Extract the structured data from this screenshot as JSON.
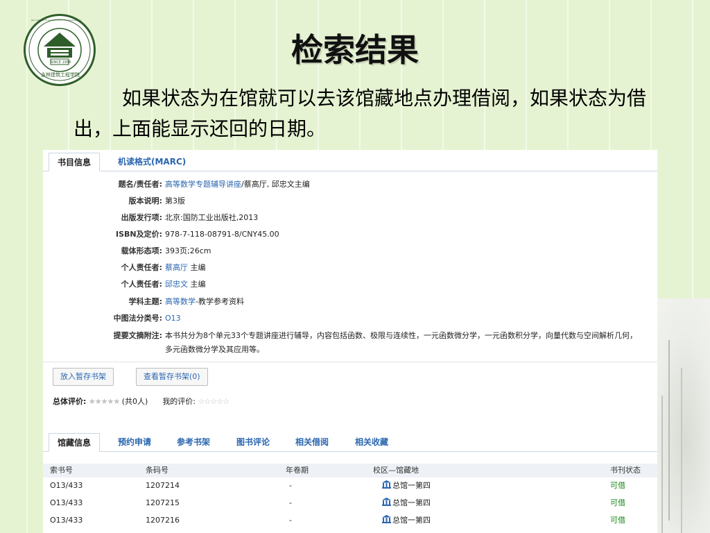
{
  "slide": {
    "title": "检索结果",
    "body": "如果状态为在馆就可以去该馆藏地点办理借阅，如果状态为借出，上面能显示还回的日期。"
  },
  "logo": {
    "ring_text": "Jilin Institute Of Architecture & Civil Engineering",
    "since": "SINCE 1956",
    "cn_name": "吉林建筑工程学院"
  },
  "tabs_top": [
    "书目信息",
    "机读格式(MARC)"
  ],
  "record": {
    "fields": [
      {
        "label": "题名/责任者:",
        "link": "高等数学专题辅导讲座",
        "rest": "/蔡高厅, 邱忠文主编"
      },
      {
        "label": "版本说明:",
        "link": "",
        "rest": "第3版"
      },
      {
        "label": "出版发行项:",
        "link": "",
        "rest": "北京:国防工业出版社,2013"
      },
      {
        "label": "ISBN及定价:",
        "link": "",
        "rest": "978-7-118-08791-8/CNY45.00"
      },
      {
        "label": "载体形态项:",
        "link": "",
        "rest": "393页;26cm"
      },
      {
        "label": "个人责任者:",
        "link": "蔡高厅",
        "rest": " 主编"
      },
      {
        "label": "个人责任者:",
        "link": "邱忠文",
        "rest": " 主编"
      },
      {
        "label": "学科主题:",
        "link": "高等数学",
        "rest": "-教学参考资料"
      },
      {
        "label": "中图法分类号:",
        "link": "O13",
        "rest": ""
      },
      {
        "label": "提要文摘附注:",
        "link": "",
        "rest": "本书共分为8个单元33个专题讲座进行辅导，内容包括函数、极限与连续性，一元函数微分学，一元函数积分学，向量代数与空间解析几何，多元函数微分学及其应用等。"
      }
    ]
  },
  "buttons": {
    "add_shelf": "放入暂存书架",
    "view_shelf": "查看暂存书架(0)"
  },
  "rating": {
    "overall_label": "总体评价:",
    "overall_count": "(共0人)",
    "my_label": "我的评价:"
  },
  "tabs_bottom": [
    "馆藏信息",
    "预约申请",
    "参考书架",
    "图书评论",
    "相关借阅",
    "相关收藏"
  ],
  "holdings": {
    "headers": [
      "索书号",
      "条码号",
      "年卷期",
      "校区—馆藏地",
      "书刊状态"
    ],
    "rows": [
      [
        "O13/433",
        "1207214",
        "-",
        "总馆一第四",
        "可借"
      ],
      [
        "O13/433",
        "1207215",
        "-",
        "总馆一第四",
        "可借"
      ],
      [
        "O13/433",
        "1207216",
        "-",
        "总馆一第四",
        "可借"
      ]
    ]
  },
  "colors": {
    "link": "#2a66b0",
    "available": "#1a8a1a",
    "slide_bg": "#e6f3d2",
    "logo_green": "#2f5e2a"
  }
}
